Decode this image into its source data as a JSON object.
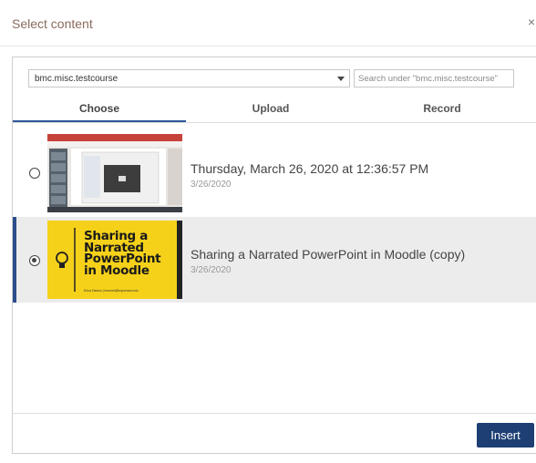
{
  "dialog": {
    "title": "Select content",
    "close_label": "×"
  },
  "filter": {
    "course_value": "bmc.misc.testcourse",
    "search_placeholder": "Search under \"bmc.misc.testcourse\""
  },
  "tabs": [
    {
      "label": "Choose",
      "active": true
    },
    {
      "label": "Upload",
      "active": false
    },
    {
      "label": "Record",
      "active": false
    }
  ],
  "items": [
    {
      "title": "Thursday, March 26, 2020 at 12:36:57 PM",
      "date": "3/26/2020",
      "selected": false
    },
    {
      "title": "Sharing a Narrated PowerPoint in Moodle (copy)",
      "date": "3/26/2020",
      "selected": true,
      "thumbnail_text": "Sharing a Narrated PowerPoint in Moodle",
      "thumbnail_footer": "Erica Daviso | bmcnet@brynmawr.edu"
    }
  ],
  "footer": {
    "insert_label": "Insert"
  },
  "colors": {
    "accent": "#2b579a",
    "insert_button": "#1e3f73",
    "thumbnail_yellow": "#f5d11a"
  }
}
